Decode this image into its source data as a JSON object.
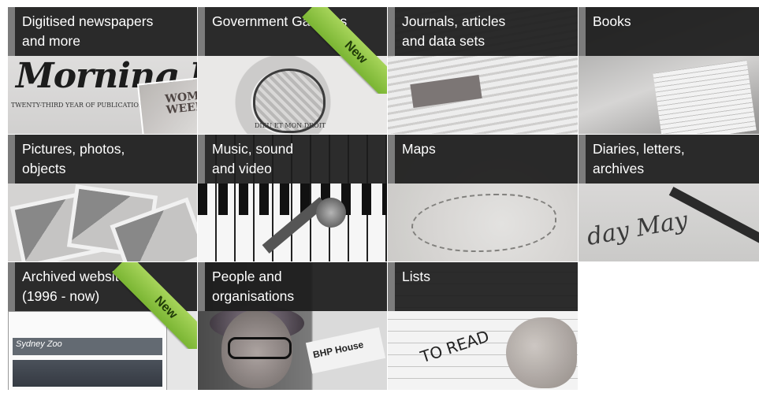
{
  "tiles": [
    {
      "id": "newspapers",
      "label": "Digitised newspapers\nand more",
      "masthead": "Morning Herald.",
      "small": "TWENTY-THIRD YEAR OF PUBLICATION",
      "magazine": "WOMEN'S\nWEEKLY"
    },
    {
      "id": "gazettes",
      "label": "Government Gazettes",
      "badge": "New",
      "motto": "DIEU ET MON DROIT"
    },
    {
      "id": "journals",
      "label": "Journals, articles\nand data sets"
    },
    {
      "id": "books",
      "label": "Books"
    },
    {
      "id": "pictures",
      "label": "Pictures, photos,\nobjects"
    },
    {
      "id": "music",
      "label": "Music, sound\nand video"
    },
    {
      "id": "maps",
      "label": "Maps"
    },
    {
      "id": "diaries",
      "label": "Diaries, letters,\narchives",
      "script": "day May"
    },
    {
      "id": "websites",
      "label": "Archived websites\n(1996 - now)",
      "badge": "New",
      "logo": "Sydney Zoo"
    },
    {
      "id": "people",
      "label": "People and\norganisations",
      "sign": "BHP House"
    },
    {
      "id": "lists",
      "label": "Lists",
      "note": "TO READ"
    }
  ],
  "colors": {
    "label_bg": "#1c1c1c",
    "label_accent": "#7c7c7c",
    "badge": "#8bc34a"
  }
}
